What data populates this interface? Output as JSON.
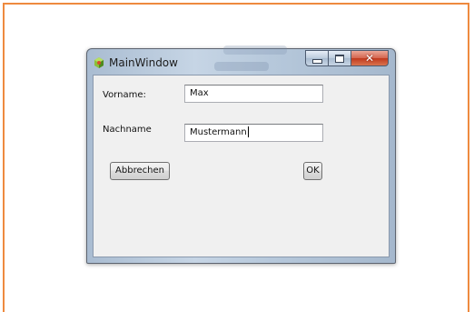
{
  "window": {
    "title": "MainWindow",
    "icon": "qt-app-icon",
    "caption_buttons": [
      "minimize-icon",
      "maximize-icon",
      "close-icon"
    ],
    "close_glyph": "✕"
  },
  "form": {
    "vorname_label": "Vorname:",
    "vorname_value": "Max",
    "nachname_label": "Nachname",
    "nachname_value": "Mustermann"
  },
  "buttons": {
    "cancel_label": "Abbrechen",
    "ok_label": "OK"
  },
  "colors": {
    "frame_border": "#ee8a3f",
    "close_button": "#c1391d"
  }
}
